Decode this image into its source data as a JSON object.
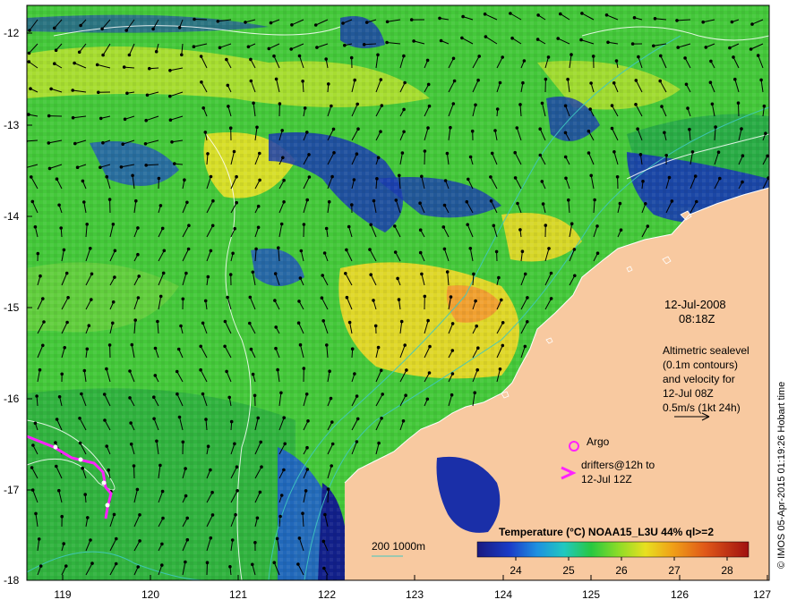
{
  "map": {
    "y_ticks": [
      "-12",
      "-13",
      "-14",
      "-15",
      "-16",
      "-17",
      "-18"
    ],
    "x_ticks": [
      "119",
      "120",
      "121",
      "122",
      "123",
      "124",
      "125",
      "126",
      "127"
    ],
    "date": "12-Jul-2008",
    "time": "08:18Z",
    "altimetry_lines": [
      "Altimetric sealevel",
      "(0.1m contours)",
      "and velocity for",
      "12-Jul 08Z",
      "0.5m/s (1kt 24h)"
    ],
    "argo_label": "Argo",
    "drifter_lines": [
      "drifters@12h to",
      "12-Jul 12Z"
    ],
    "depth_label": "200  1000m",
    "colorbar_title": "Temperature (°C) NOAA15_L3U 44% ql>=2",
    "colorbar_ticks": [
      "24",
      "25",
      "26",
      "27",
      "28"
    ],
    "credit": "© IMOS 05-Apr-2015 01:19:26 Hobart time",
    "colors": {
      "land": "#f8c9a0",
      "cold": "#1a2fa8",
      "mid": "#2ec832",
      "warm": "#e8d820",
      "hot": "#e07020",
      "drifter": "#ff22ff",
      "isobath": "#3fc8c0",
      "contour": "#ffffff"
    }
  }
}
